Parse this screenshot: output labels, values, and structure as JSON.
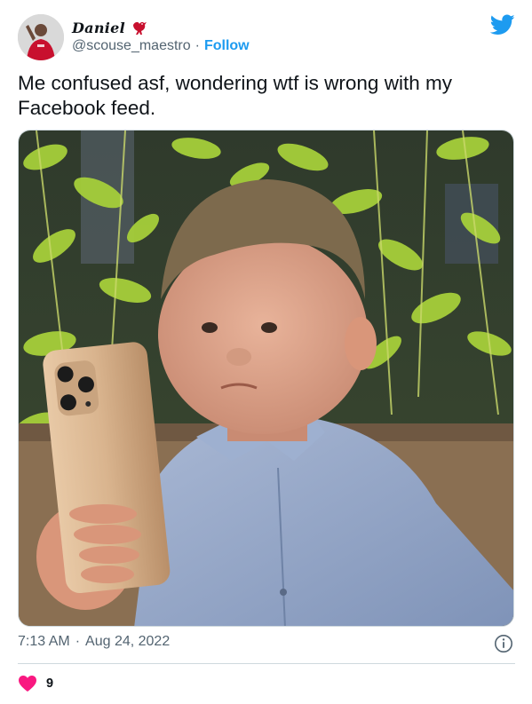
{
  "author": {
    "display_name": "Daniel",
    "handle": "@scouse_maestro",
    "separator": "·",
    "follow_label": "Follow",
    "avatar_icon": "avatar-image",
    "badge_icon": "liver-bird-icon"
  },
  "tweet": {
    "text": "Me confused asf, wondering wtf is wrong with my Facebook feed.",
    "media_icon": "tweet-photo"
  },
  "meta": {
    "time": "7:13 AM",
    "separator": "·",
    "date": "Aug 24, 2022",
    "info_icon": "info-icon"
  },
  "engagement": {
    "likes": "9",
    "like_icon": "heart-icon"
  },
  "colors": {
    "brand_blue": "#1d9bf0",
    "heart_red": "#f91880",
    "text_primary": "#0f1419",
    "text_secondary": "#536471",
    "divider": "#cfd9de"
  }
}
